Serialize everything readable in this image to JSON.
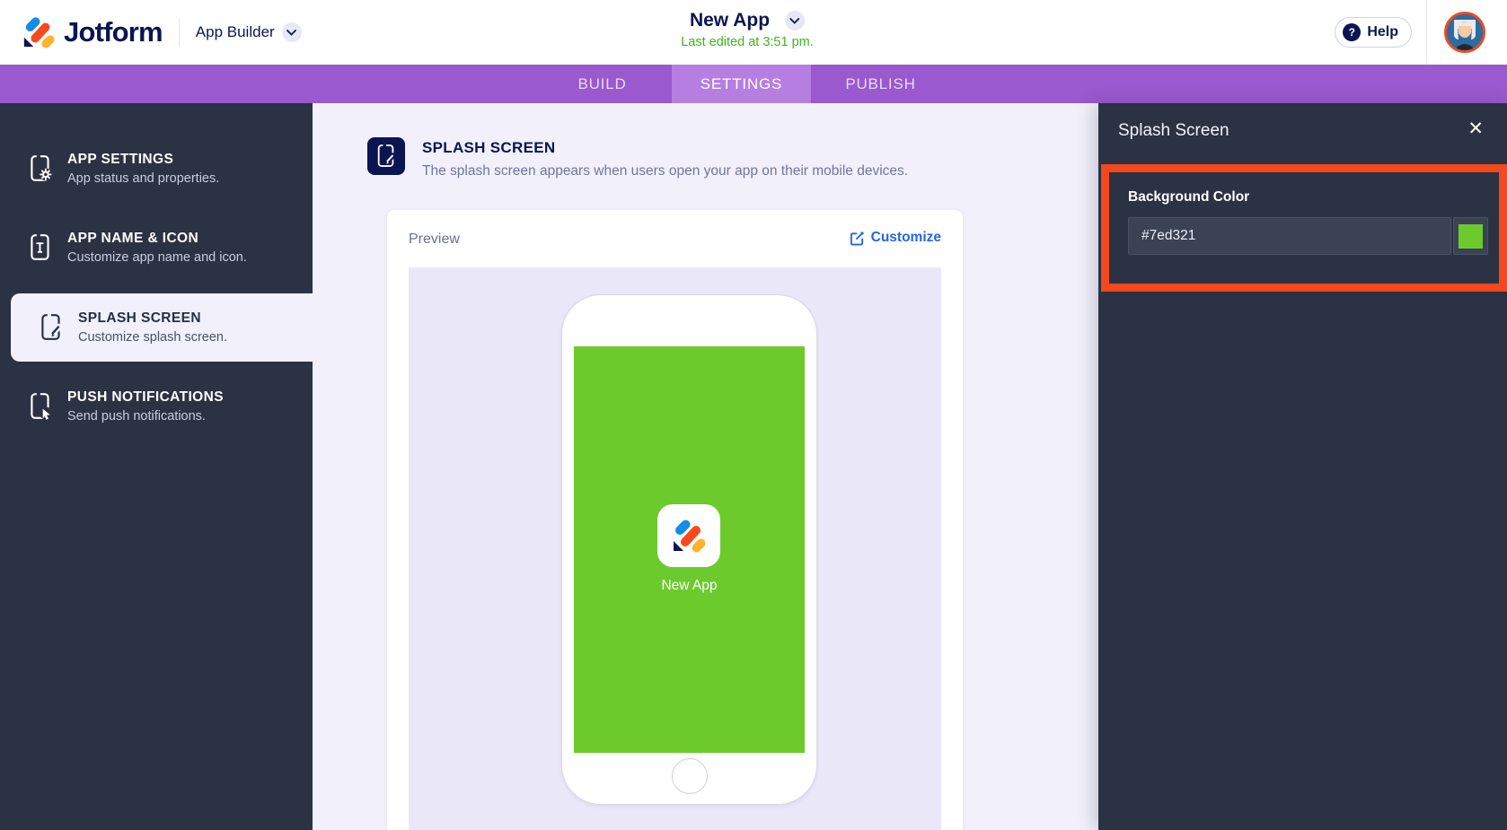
{
  "header": {
    "brand": "Jotform",
    "product": "App Builder",
    "app_title": "New App",
    "last_edited": "Last edited at 3:51 pm.",
    "help_label": "Help",
    "logo_icon": "jotform-logo-icon",
    "avatar_icon": "user-avatar"
  },
  "nav": {
    "tabs": [
      {
        "label": "BUILD",
        "active": false
      },
      {
        "label": "SETTINGS",
        "active": true
      },
      {
        "label": "PUBLISH",
        "active": false
      }
    ]
  },
  "sidebar": {
    "items": [
      {
        "title": "APP SETTINGS",
        "subtitle": "App status and properties.",
        "icon": "phone-gear-icon",
        "active": false
      },
      {
        "title": "APP NAME & ICON",
        "subtitle": "Customize app name and icon.",
        "icon": "phone-text-icon",
        "active": false
      },
      {
        "title": "SPLASH SCREEN",
        "subtitle": "Customize splash screen.",
        "icon": "phone-edit-icon",
        "active": true
      },
      {
        "title": "PUSH NOTIFICATIONS",
        "subtitle": "Send push notifications.",
        "icon": "phone-push-icon",
        "active": false
      }
    ]
  },
  "content": {
    "section_title": "SPLASH SCREEN",
    "section_description": "The splash screen appears when users open your app on their mobile devices.",
    "section_icon": "phone-edit-tile-icon",
    "preview_label": "Preview",
    "customize_label": "Customize",
    "customize_icon": "edit-icon",
    "phone": {
      "app_name": "New App",
      "screen_color": "#6dca2d",
      "app_icon": "jotform-logo-icon"
    }
  },
  "panel": {
    "title": "Splash Screen",
    "close_label": "✕",
    "background_color_label": "Background Color",
    "background_color_value": "#7ed321",
    "swatch_color": "#6dca2d"
  },
  "colors": {
    "navbar_purple": "#9a59ce",
    "active_tab_purple": "#b77ee1",
    "sidebar_dark": "#2b3243",
    "highlight_orange": "#f4481e",
    "link_blue": "#2465e8",
    "edited_green": "#3fb41a",
    "brand_navy": "#0a1551"
  }
}
